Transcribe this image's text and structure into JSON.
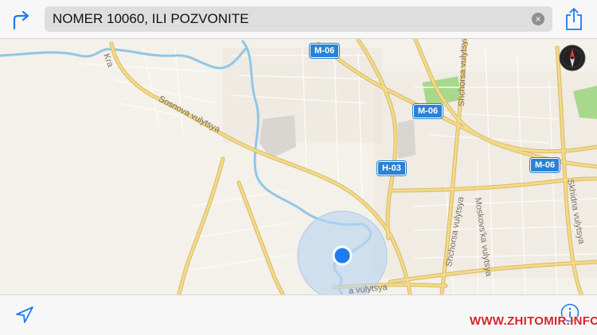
{
  "search": {
    "value": "NOMER 10060, ILI POZVONITE"
  },
  "icons": {
    "directions": "directions-arrow-icon",
    "clear": "clear-circle-icon",
    "share": "share-icon",
    "locate": "location-arrow-icon",
    "info": "info-icon",
    "compass": "compass-icon"
  },
  "route_shields": [
    "M-06",
    "M-06",
    "M-06",
    "H-03"
  ],
  "streets": {
    "sosnova": "Sosnova vulytsya",
    "shchorsa_top": "Shchorsa vulytsya",
    "shchorsa_mid": "Shchorsa vulytsya",
    "shchorsa_low": "Shchorsa vulytsya",
    "moskovska": "Moskovs'ka vulytsya",
    "skhidna": "Skhidna vulytsya",
    "bottom": "a vulytsya",
    "partial": "Kra"
  },
  "colors": {
    "land": "#f4f1ea",
    "road": "#f3d98a",
    "road_edge": "#d9bb63",
    "minor_road": "#ffffff",
    "water": "#8fc7e8",
    "park": "#a8d88c",
    "shield": "#2a82d6",
    "accent": "#1a7cf0",
    "location_dot": "#1e7cf2"
  },
  "watermark": "WWW.ZHITOMIR.INFO"
}
